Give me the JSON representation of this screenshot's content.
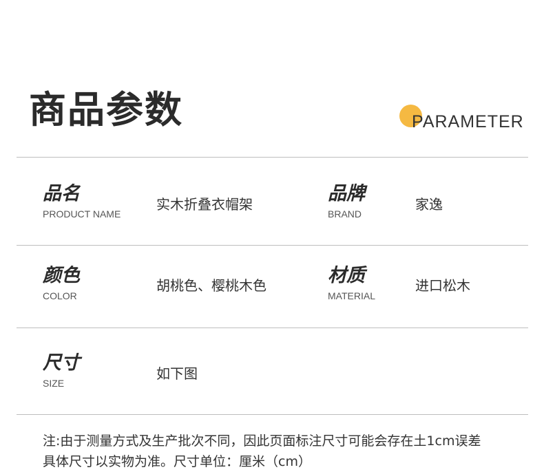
{
  "header": {
    "title": "商品参数",
    "subtitle": "PARAMETER",
    "accent_color": "#f5b942"
  },
  "params": [
    {
      "label_cn": "品名",
      "label_en": "PRODUCT NAME",
      "value": "实木折叠衣帽架"
    },
    {
      "label_cn": "品牌",
      "label_en": "BRAND",
      "value": "家逸"
    },
    {
      "label_cn": "颜色",
      "label_en": "COLOR",
      "value": "胡桃色、樱桃木色"
    },
    {
      "label_cn": "材质",
      "label_en": "MATERIAL",
      "value": "进口松木"
    },
    {
      "label_cn": "尺寸",
      "label_en": "SIZE",
      "value": "如下图"
    }
  ],
  "note": {
    "line1": "注:由于测量方式及生产批次不同，因此页面标注尺寸可能会存在土1cm误差",
    "line2": "具体尺寸以实物为准。尺寸单位：厘米（cm）"
  }
}
